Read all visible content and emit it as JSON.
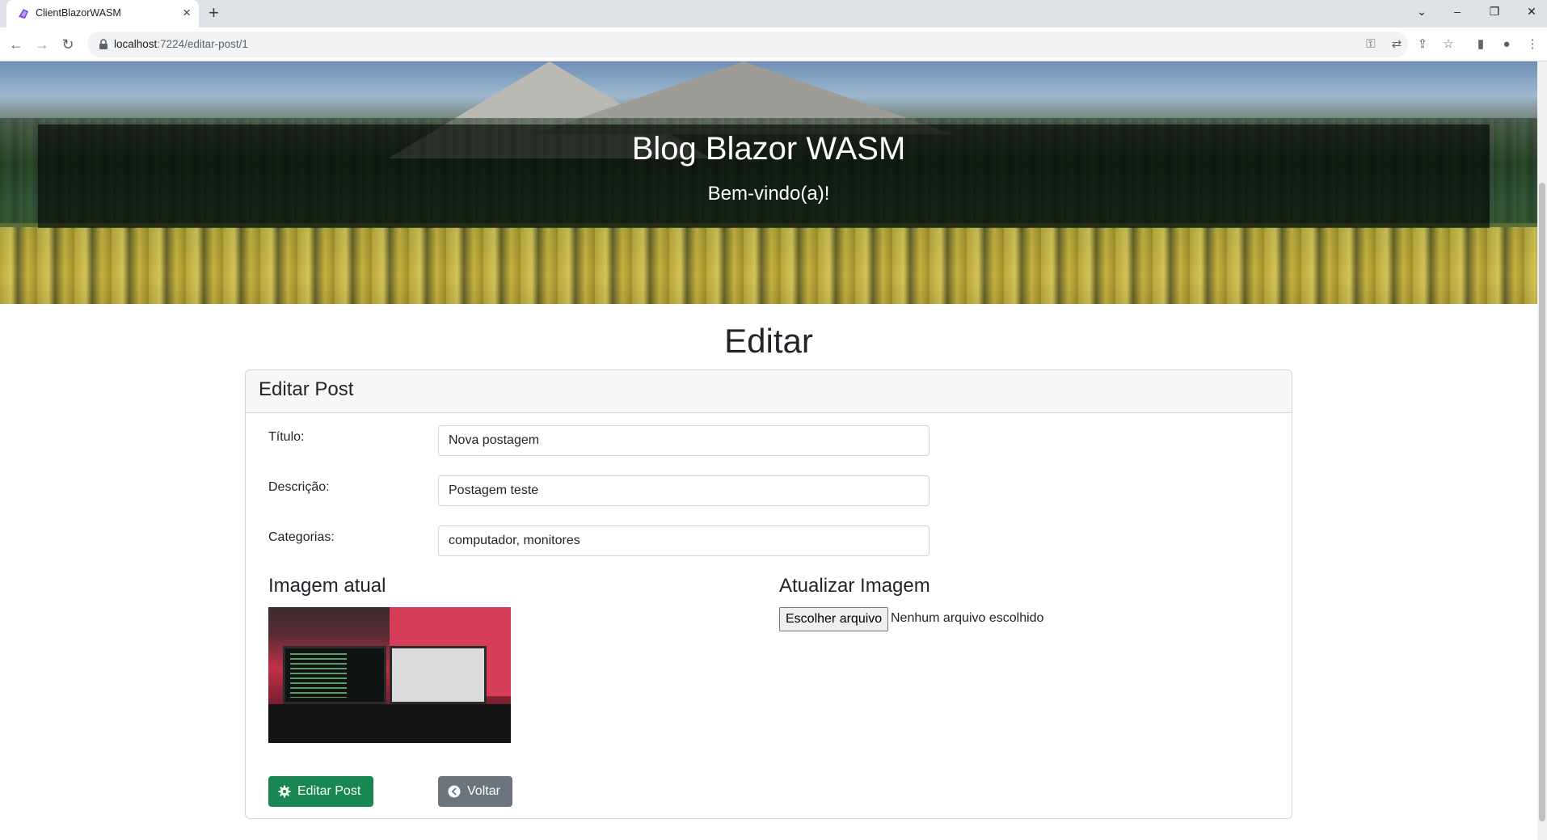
{
  "browser": {
    "tab_title": "ClientBlazorWASM",
    "url_host": "localhost",
    "url_path": ":7224/editar-post/1"
  },
  "hero": {
    "title": "Blog Blazor WASM",
    "subtitle": "Bem-vindo(a)!"
  },
  "page": {
    "heading": "Editar"
  },
  "card": {
    "title": "Editar Post",
    "fields": {
      "titulo": {
        "label": "Título:",
        "value": "Nova postagem"
      },
      "descricao": {
        "label": "Descrição:",
        "value": "Postagem teste"
      },
      "categorias": {
        "label": "Categorias:",
        "value": "computador, monitores"
      }
    },
    "current_image_title": "Imagem atual",
    "update_image_title": "Atualizar Imagem",
    "file_button_label": "Escolher arquivo",
    "file_status": "Nenhum arquivo escolhido",
    "submit_label": "Editar Post",
    "back_label": "Voltar"
  },
  "colors": {
    "success": "#198754",
    "secondary": "#6c757d"
  }
}
